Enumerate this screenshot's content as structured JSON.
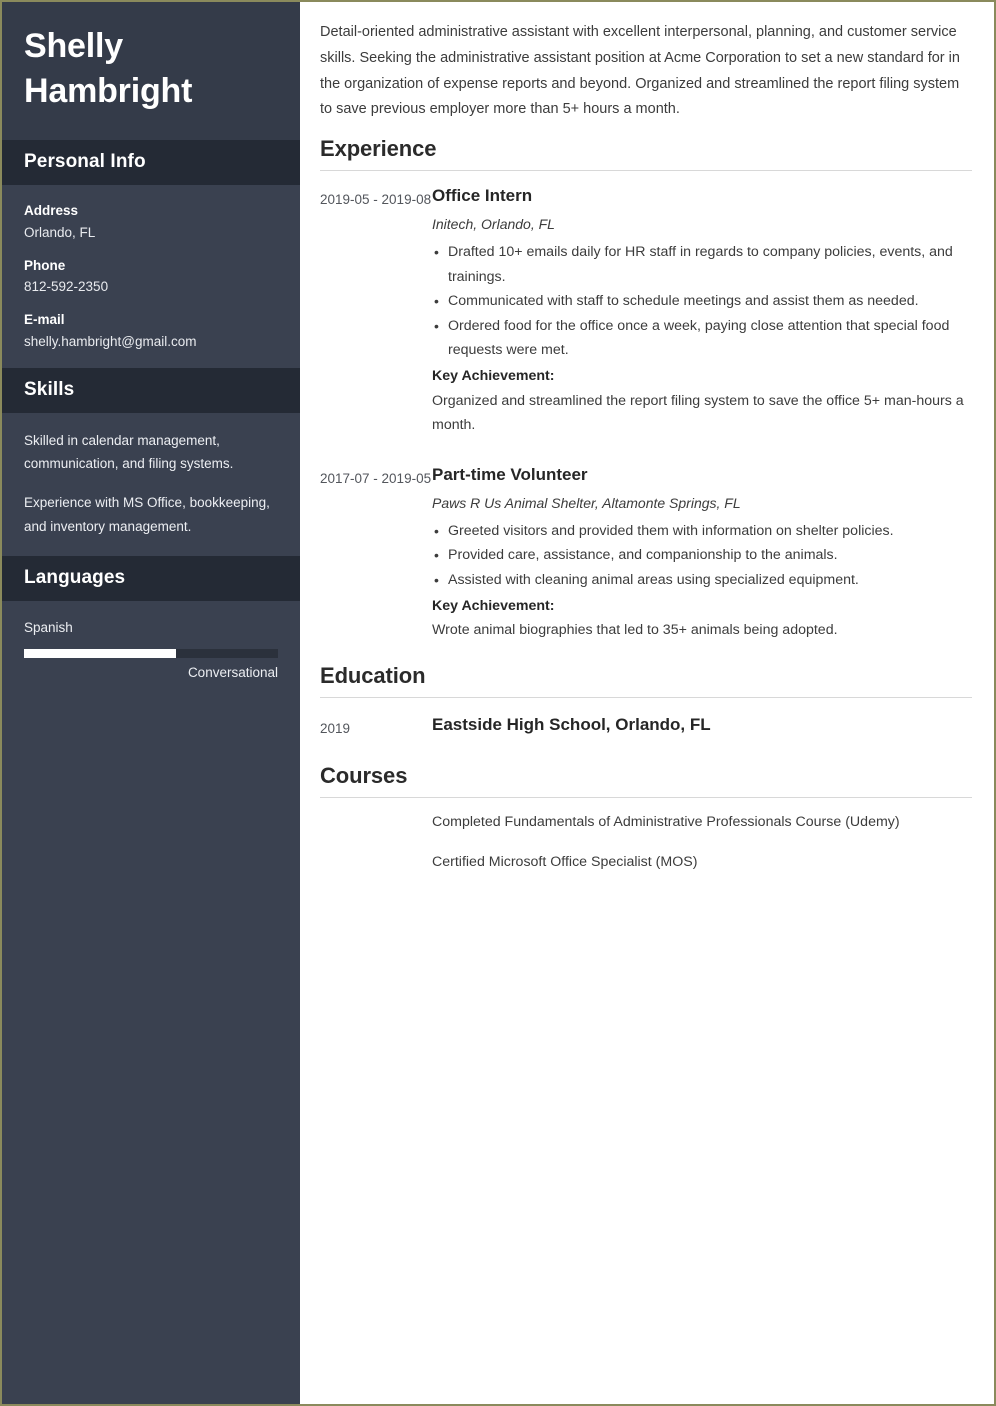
{
  "theme": {
    "sidebar_bg": "#3a4150",
    "sidebar_header_bg": "#242a35",
    "name_block_bg": "#343b49",
    "page_border": "#8a8a5c",
    "rule_color": "#d8d8d8",
    "body_text": "#3c3c3c",
    "bar_fill": "#ffffff",
    "bar_track": "#2b313c"
  },
  "sidebar": {
    "name": "Shelly Hambright",
    "personal_info": {
      "heading": "Personal Info",
      "items": [
        {
          "label": "Address",
          "value": "Orlando, FL"
        },
        {
          "label": "Phone",
          "value": "812-592-2350"
        },
        {
          "label": "E-mail",
          "value": "shelly.hambright@gmail.com"
        }
      ]
    },
    "skills": {
      "heading": "Skills",
      "paragraphs": [
        "Skilled in calendar management, communication, and filing systems.",
        "Experience with MS Office, bookkeeping, and inventory management."
      ]
    },
    "languages": {
      "heading": "Languages",
      "items": [
        {
          "name": "Spanish",
          "level": "Conversational",
          "percent": 60
        }
      ]
    }
  },
  "main": {
    "summary": "Detail-oriented administrative assistant with excellent interpersonal, planning, and customer service skills. Seeking the administrative assistant position at Acme Corporation to set a new standard for in the organization of expense reports and beyond. Organized and streamlined the report filing system to save previous employer more than 5+ hours a month.",
    "experience": {
      "heading": "Experience",
      "entries": [
        {
          "dates": "2019-05 - 2019-08",
          "title": "Office Intern",
          "subtitle": "Initech, Orlando, FL",
          "bullets": [
            "Drafted 10+ emails daily for HR staff in regards to company policies, events, and trainings.",
            "Communicated with staff to schedule meetings and assist them as needed.",
            "Ordered food for the office once a week, paying close attention that special food requests were met."
          ],
          "achievement_label": "Key Achievement:",
          "achievement_text": "Organized and streamlined the report filing system to save the office 5+ man-hours a month."
        },
        {
          "dates": "2017-07 - 2019-05",
          "title": "Part-time Volunteer",
          "subtitle": "Paws R Us Animal Shelter, Altamonte Springs, FL",
          "bullets": [
            "Greeted visitors and provided them with information on shelter policies.",
            "Provided care, assistance, and companionship to the animals.",
            "Assisted with cleaning animal areas using specialized equipment."
          ],
          "achievement_label": "Key Achievement:",
          "achievement_text": "Wrote animal biographies that led to 35+ animals being adopted."
        }
      ]
    },
    "education": {
      "heading": "Education",
      "entries": [
        {
          "year": "2019",
          "title": "Eastside High School, Orlando, FL"
        }
      ]
    },
    "courses": {
      "heading": "Courses",
      "items": [
        "Completed Fundamentals of Administrative Professionals Course (Udemy)",
        "Certified Microsoft Office Specialist (MOS)"
      ]
    }
  }
}
